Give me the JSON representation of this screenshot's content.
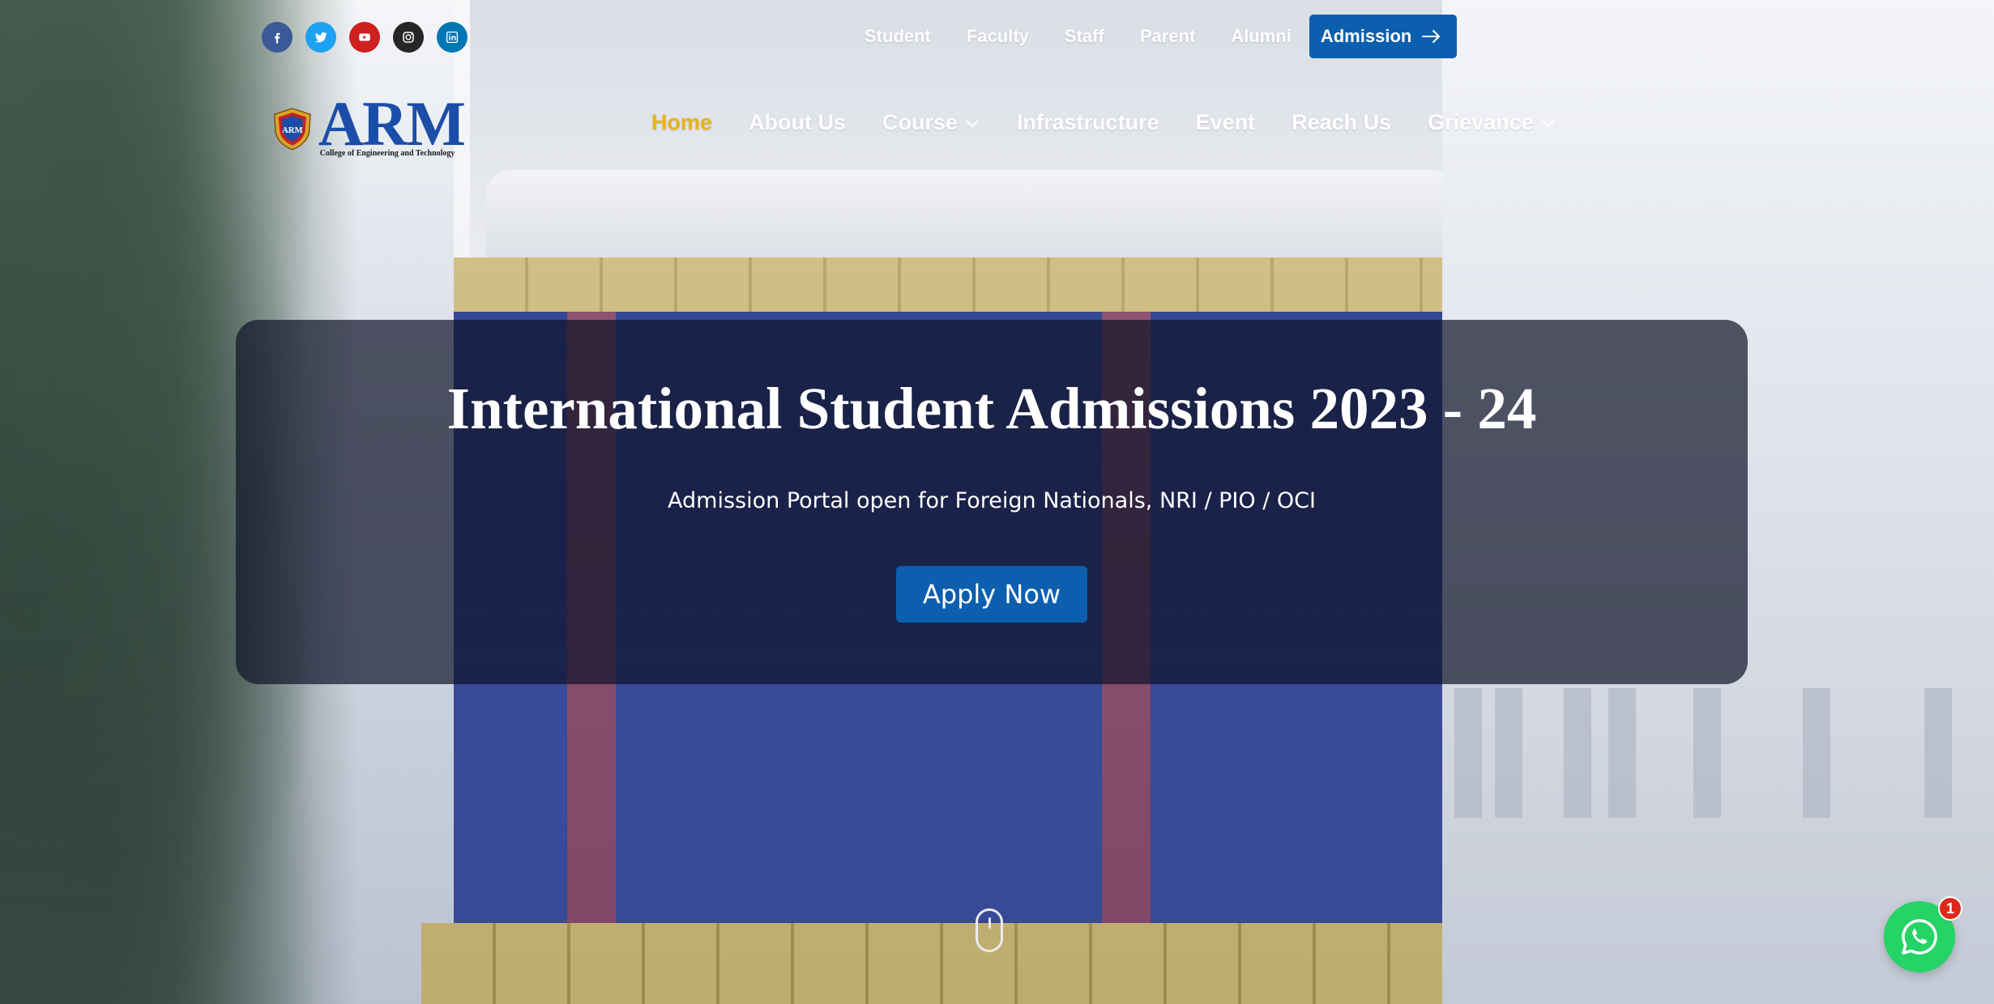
{
  "social": {
    "icons": [
      "facebook-icon",
      "twitter-icon",
      "youtube-icon",
      "instagram-icon",
      "linkedin-icon"
    ],
    "colors": {
      "facebook": "#3b5998",
      "twitter": "#1da1f2",
      "youtube": "#cd201f",
      "instagram": "#262626",
      "linkedin": "#0077b5"
    }
  },
  "utility_nav": {
    "links": [
      "Student",
      "Faculty",
      "Staff",
      "Parent",
      "Alumni"
    ],
    "admission_label": "Admission"
  },
  "logo": {
    "brand": "ARM",
    "crest_text": "ARM",
    "subtitle": "College of Engineering and Technology"
  },
  "main_nav": {
    "items": [
      {
        "label": "Home",
        "active": true
      },
      {
        "label": "About Us"
      },
      {
        "label": "Course",
        "dropdown": true
      },
      {
        "label": "Infrastructure"
      },
      {
        "label": "Event"
      },
      {
        "label": "Reach Us"
      },
      {
        "label": "Grievance",
        "dropdown": true
      }
    ],
    "active_color": "#e8b41c"
  },
  "hero": {
    "title": "International Student Admissions 2023 - 24",
    "subtitle": "Admission Portal open for Foreign Nationals, NRI / PIO / OCI",
    "cta_label": "Apply Now"
  },
  "whatsapp": {
    "badge_count": "1",
    "color": "#25d366"
  },
  "theme": {
    "primary": "#0b5fae"
  }
}
